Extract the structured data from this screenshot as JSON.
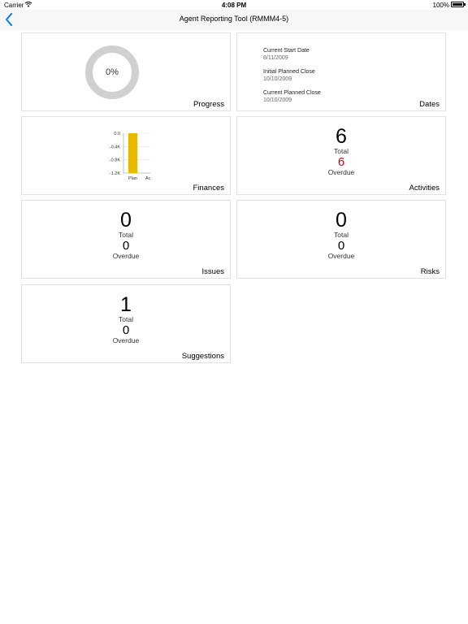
{
  "status_bar": {
    "carrier": "Carrier",
    "time": "4:08 PM",
    "battery": "100%"
  },
  "nav": {
    "title": "Agent Reporting Tool (RMMM4-5)"
  },
  "progress": {
    "percent_text": "0%",
    "percent_value": 0,
    "label": "Progress"
  },
  "dates": {
    "label": "Dates",
    "items": [
      {
        "name": "Current Start Date",
        "value": "8/11/2009"
      },
      {
        "name": "Initial Planned Close",
        "value": "10/10/2009"
      },
      {
        "name": "Current Planned Close",
        "value": "10/10/2009"
      }
    ]
  },
  "finances": {
    "label": "Finances"
  },
  "activities": {
    "label": "Activities",
    "total": "6",
    "total_label": "Total",
    "overdue": "6",
    "overdue_label": "Overdue"
  },
  "issues": {
    "label": "Issues",
    "total": "0",
    "total_label": "Total",
    "overdue": "0",
    "overdue_label": "Overdue"
  },
  "risks": {
    "label": "Risks",
    "total": "0",
    "total_label": "Total",
    "overdue": "0",
    "overdue_label": "Overdue"
  },
  "suggestions": {
    "label": "Suggestions",
    "total": "1",
    "total_label": "Total",
    "overdue": "0",
    "overdue_label": "Overdue"
  },
  "colors": {
    "accent": "#007aff",
    "bar": "#e8b800",
    "overdue_alert": "#d0021b",
    "ring": "#d0d0d0"
  },
  "chart_data": {
    "type": "bar",
    "categories": [
      "Plan",
      "Actual"
    ],
    "values": [
      -1.2,
      0
    ],
    "ylim": [
      -1.2,
      0
    ],
    "yticks": [
      "0.0",
      "-0.4K",
      "-0.8K",
      "-1.2K"
    ],
    "grid": true
  }
}
